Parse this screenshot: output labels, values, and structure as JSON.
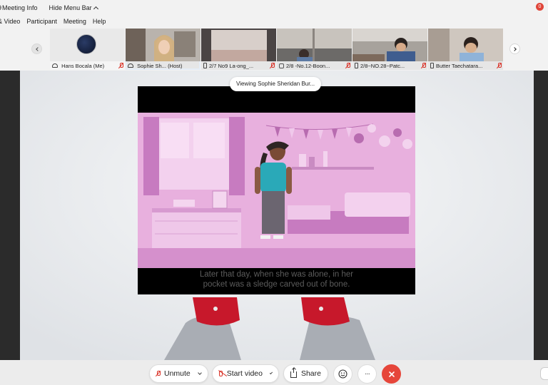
{
  "menu": {
    "row1": [
      "Meeting Info",
      "Hide Menu Bar"
    ],
    "row2": [
      "& Video",
      "Participant",
      "Meeting",
      "Help"
    ],
    "notification_count": "0",
    "partial_left_glyph": "9"
  },
  "participants": [
    {
      "name": "Hans Bocala",
      "tag": "(Me)"
    },
    {
      "name": "Sophie Sh...",
      "tag": "(Host)"
    },
    {
      "name": "2/7 No9 La-ong_..."
    },
    {
      "name": "2/8 -No.12-Boon..."
    },
    {
      "name": "2/8~NO.28~Patc..."
    },
    {
      "name": "Butter Taechatara..."
    }
  ],
  "viewing_label": "Viewing Sophie Sheridan Bur...",
  "shared_video": {
    "caption": "Later that day, when she was alone, in her\npocket was a sledge carved out of bone."
  },
  "toolbar": {
    "unmute": "Unmute",
    "start_video": "Start video",
    "share": "Share",
    "more": "···",
    "reactions_icon": "smiley-icon",
    "end_icon": "close-icon"
  },
  "colors": {
    "accent_blue": "#2d8cff",
    "muted_red": "#d93025",
    "end_red": "#e6463a",
    "scene_pink": "#e6a9dc"
  }
}
